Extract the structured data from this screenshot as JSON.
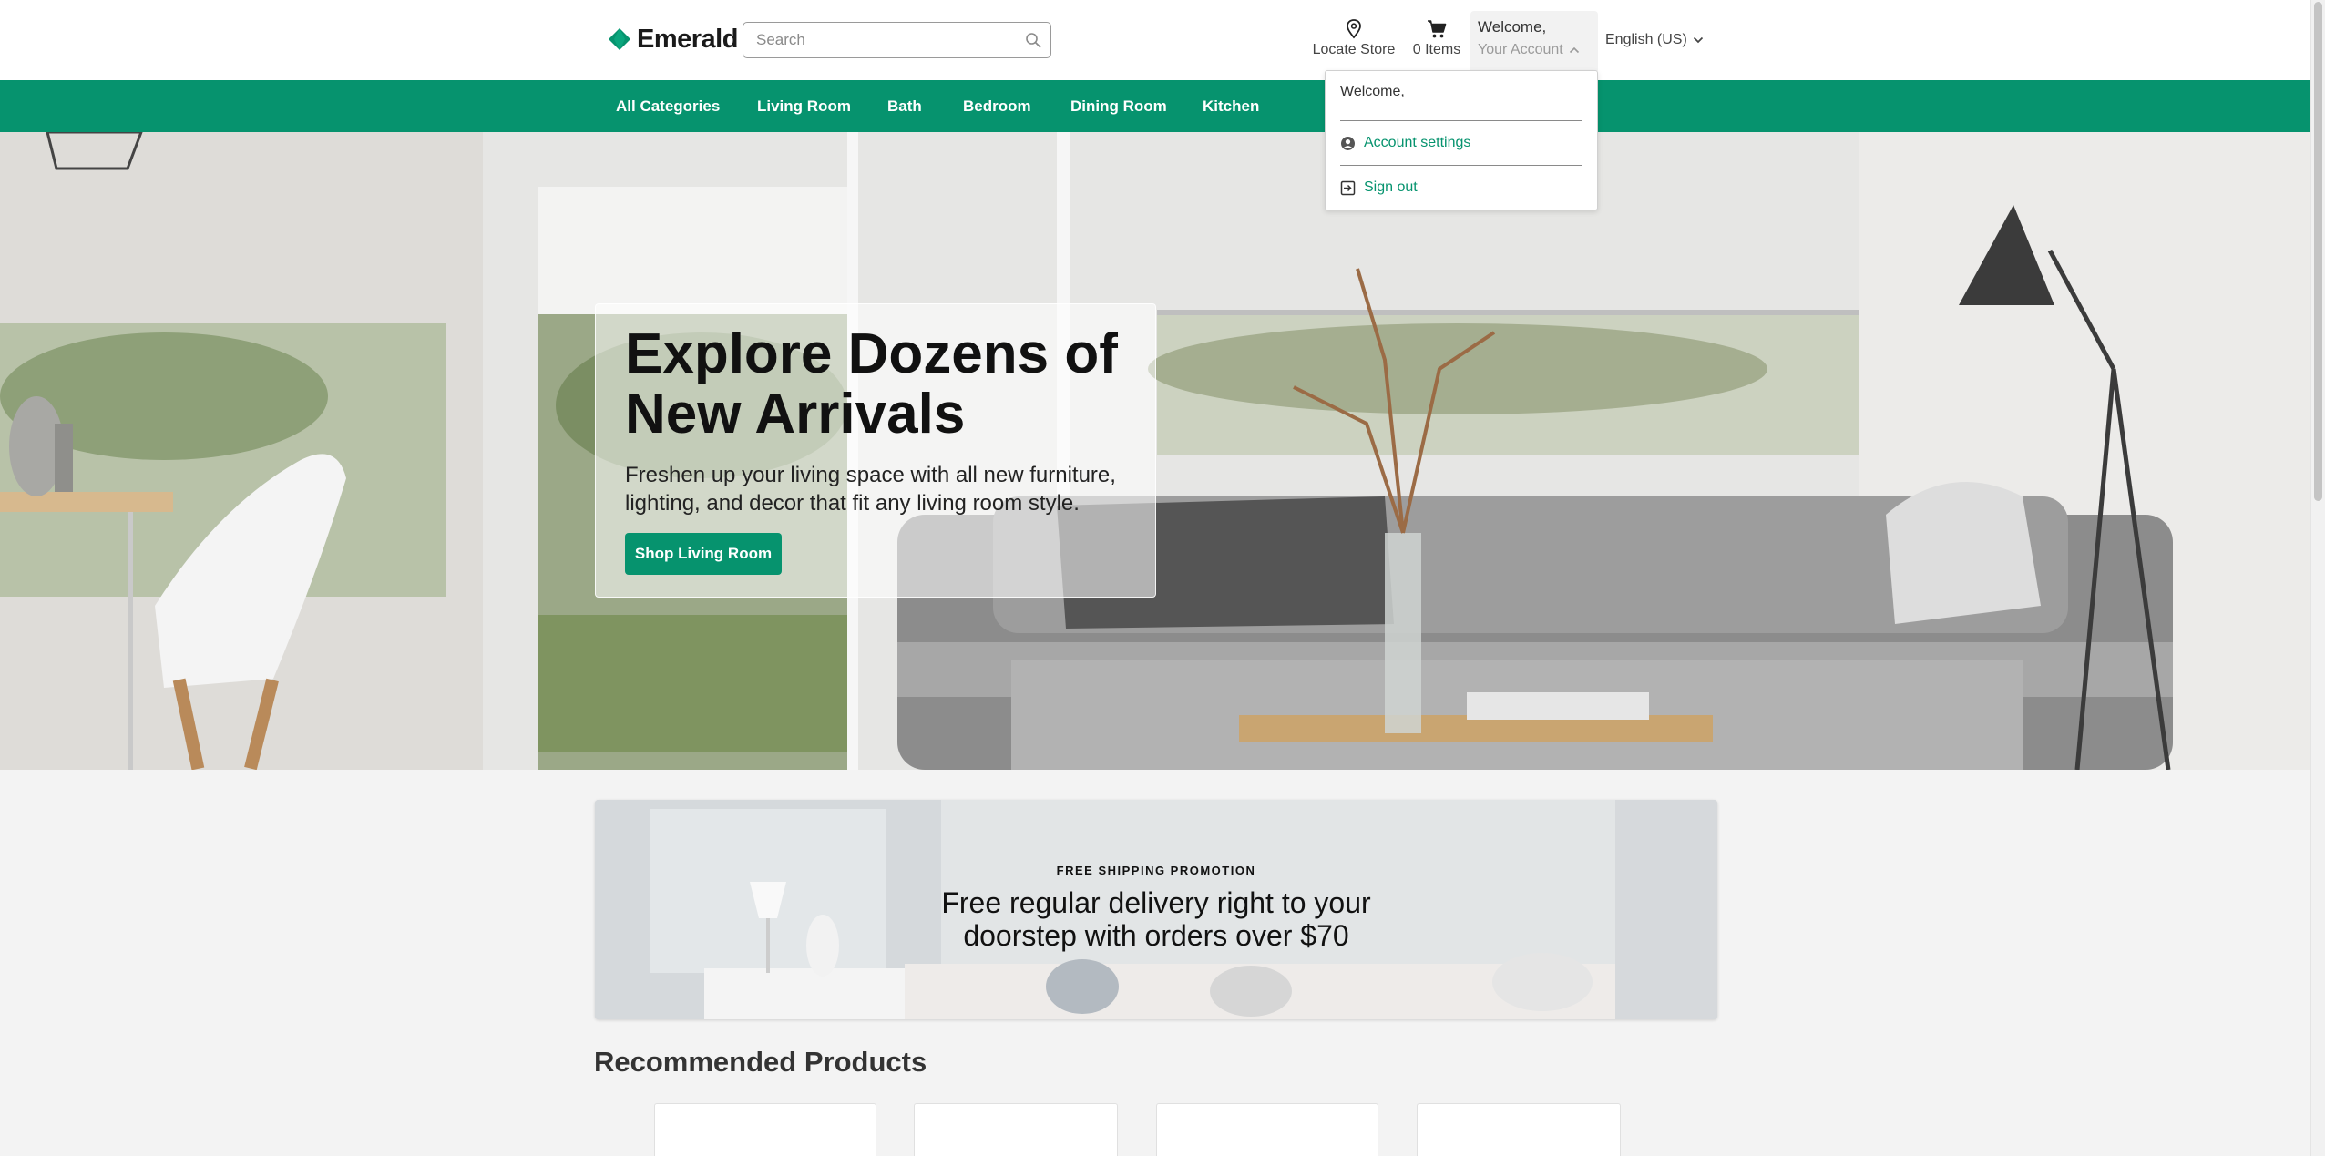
{
  "brand": {
    "name": "Emerald",
    "accent": "#06936e"
  },
  "search": {
    "placeholder": "Search",
    "value": ""
  },
  "header": {
    "locate_label": "Locate Store",
    "cart_label": "0 Items",
    "account_welcome": "Welcome,",
    "account_label": "Your Account",
    "language_label": "English (US)"
  },
  "nav": {
    "items": [
      {
        "label": "All Categories"
      },
      {
        "label": "Living Room"
      },
      {
        "label": "Bath"
      },
      {
        "label": "Bedroom"
      },
      {
        "label": "Dining Room"
      },
      {
        "label": "Kitchen"
      }
    ]
  },
  "hero": {
    "title": "Explore Dozens of New Arrivals",
    "subtitle": "Freshen up your living space with all new furniture, lighting, and decor that fit any living room style.",
    "button_label": "Shop Living Room"
  },
  "promo": {
    "eyebrow": "FREE SHIPPING PROMOTION",
    "text": "Free regular delivery right to your doorstep with orders over $70"
  },
  "recommended": {
    "title": "Recommended Products"
  },
  "account_menu": {
    "welcome": "Welcome,",
    "items": [
      {
        "label": "Account settings",
        "icon": "user-circle-icon"
      },
      {
        "label": "Sign out",
        "icon": "sign-out-icon"
      }
    ]
  }
}
